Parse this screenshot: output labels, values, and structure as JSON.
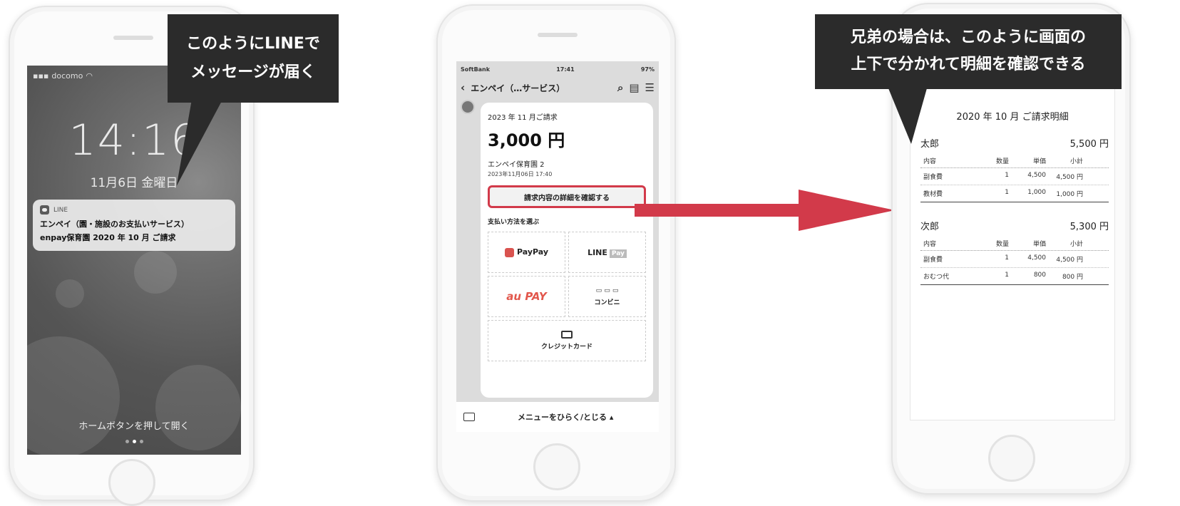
{
  "callouts": {
    "line_message": [
      "このようにLINEで",
      "メッセージが届く"
    ],
    "siblings": [
      "兄弟の場合は、このように画面の",
      "上下で分かれて明細を確認できる"
    ]
  },
  "lock_screen": {
    "carrier": "docomo",
    "time": "14:16",
    "date": "11月6日 金曜日",
    "notification": {
      "app": "LINE",
      "title": "エンペイ（園・施設のお支払いサービス）",
      "body": "enpay保育園 2020 年 10 月 ご請求"
    },
    "hint": "ホームボタンを押して開く"
  },
  "line_chat": {
    "status": {
      "carrier": "SoftBank",
      "time": "17:41",
      "battery": "97%"
    },
    "header_title": "エンペイ（…サービス）",
    "invoice": {
      "month": "2023 年 11 月ご請求",
      "amount": "3,000 円",
      "school": "エンペイ保育園 2",
      "datetime": "2023年11月06日 17:40",
      "detail_button": "請求内容の詳細を確認する",
      "pay_method_label": "支払い方法を選ぶ"
    },
    "payment_methods": {
      "paypay": "PayPay",
      "linepay_line": "LINE",
      "linepay_pay": "Pay",
      "aupay": "au PAY",
      "konbini": "コンビニ",
      "credit": "クレジットカード"
    },
    "footer_menu": "メニューをひらく/とじる ▴"
  },
  "statement": {
    "title": "2020 年 10 月 ご請求明細",
    "columns": [
      "内容",
      "数量",
      "単価",
      "小計"
    ],
    "siblings": [
      {
        "name": "太郎",
        "total": "5,500 円",
        "rows": [
          [
            "副食費",
            "1",
            "4,500",
            "4,500 円"
          ],
          [
            "教材費",
            "1",
            "1,000",
            "1,000 円"
          ]
        ]
      },
      {
        "name": "次郎",
        "total": "5,300 円",
        "rows": [
          [
            "副食費",
            "1",
            "4,500",
            "4,500 円"
          ],
          [
            "おむつ代",
            "1",
            "800",
            "800 円"
          ]
        ]
      }
    ]
  },
  "colors": {
    "accent_red": "#d23a4a",
    "callout_bg": "#2b2b2b"
  }
}
